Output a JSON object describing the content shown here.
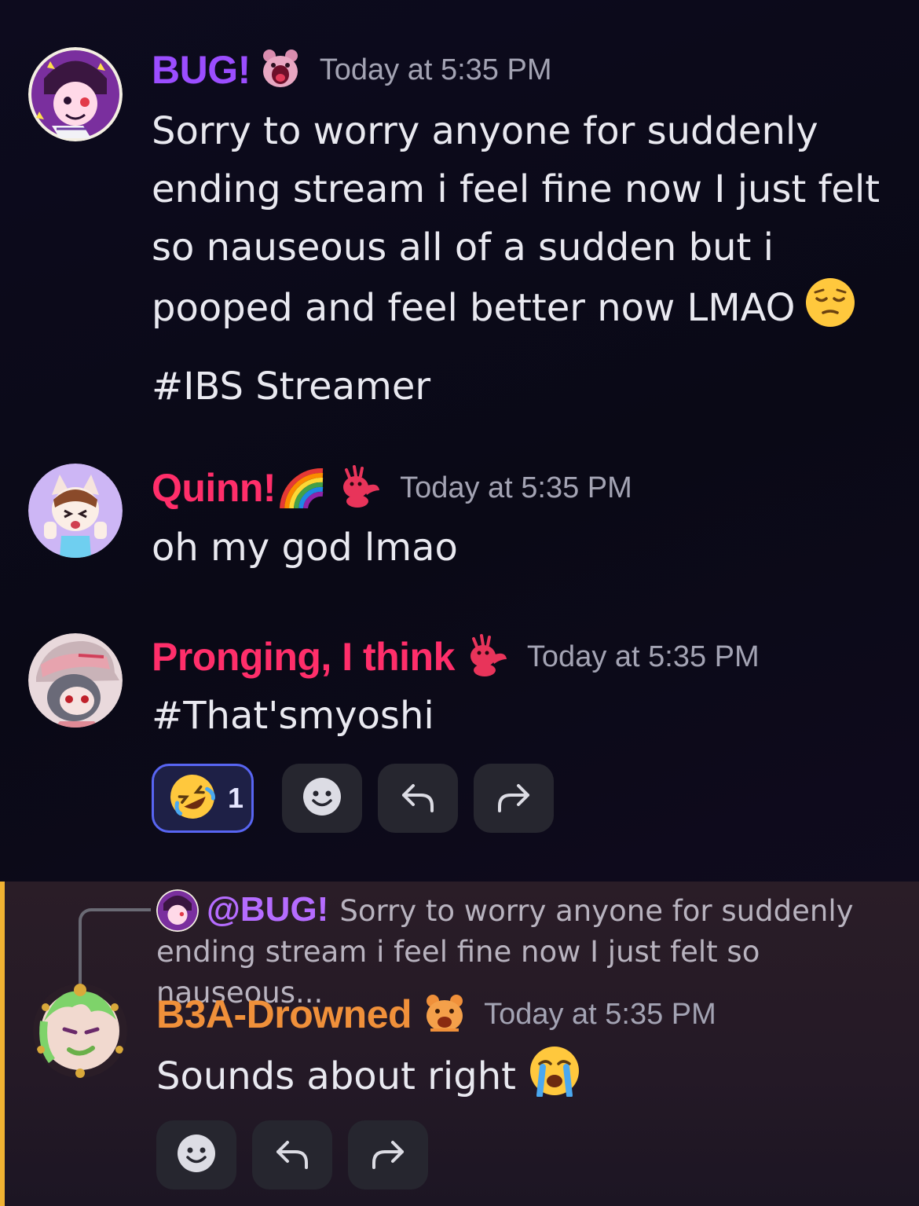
{
  "messages": [
    {
      "author": "BUG!",
      "author_color": "#9b4dff",
      "badge_icon": "pink-bear-badge-icon",
      "timestamp": "Today at 5:35 PM",
      "lines": [
        "Sorry to worry anyone for suddenly",
        "ending stream i feel fine now I just felt",
        "so nauseous all of a sudden but i",
        "pooped and feel better now LMAO"
      ],
      "line_emoji": "pensive-face-emoji",
      "extra_line": "#IBS Streamer"
    },
    {
      "author": "Quinn!",
      "author_color": "#ff2e6a",
      "badge_icons": [
        "rainbow-emoji",
        "pink-axolotl-badge-icon"
      ],
      "timestamp": "Today at 5:35 PM",
      "text": "oh my god lmao"
    },
    {
      "author": "Pronging, I think",
      "author_color": "#ff2e6a",
      "badge_icon": "pink-axolotl-badge-icon",
      "timestamp": "Today at 5:35 PM",
      "text": "#That'smyoshi",
      "reactions": [
        {
          "emoji": "rofl-emoji",
          "count": "1"
        }
      ],
      "actions": [
        "add-reaction",
        "reply",
        "forward"
      ]
    },
    {
      "reply_to": {
        "mention": "@BUG!",
        "preview": "Sorry to worry anyone for suddenly ending stream i feel fine now I just felt so nauseous..."
      },
      "author": "B3A-Drowned",
      "author_color": "#f0903a",
      "badge_icon": "orange-bear-badge-icon",
      "timestamp": "Today at 5:35 PM",
      "text": "Sounds about right",
      "text_emoji": "loudly-crying-face-emoji",
      "actions": [
        "add-reaction",
        "reply",
        "forward"
      ]
    }
  ],
  "colors": {
    "accent_reaction": "#5865f2",
    "reply_highlight": "#f0b232",
    "timestamp": "#a3a3b3"
  }
}
